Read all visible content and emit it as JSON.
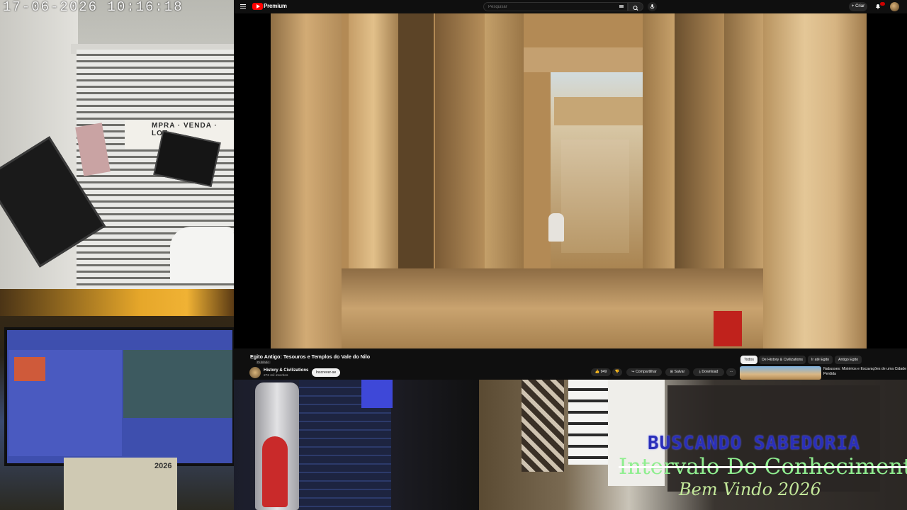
{
  "camera": {
    "timestamp": "17-06-2026  10:16:18",
    "sign_text": "MPRA · VENDA · LOT"
  },
  "youtube": {
    "brand": "Premium",
    "search_placeholder": "Pesquisar",
    "create_label": "+ Criar",
    "video_title": "Egito Antigo: Tesouros e Templos do Vale do Nilo",
    "verified_tag": "Dublado",
    "channel_name": "History & Civilizations",
    "subscribers": "276 mil inscritos",
    "subscribe_label": "Inscrever-se",
    "actions": {
      "likes": "949",
      "share": "Compartilhar",
      "save": "Salvar",
      "download": "Download",
      "more": "···"
    },
    "chips": [
      {
        "label": "Todos",
        "active": true
      },
      {
        "label": "De History & Civilizations",
        "active": false
      },
      {
        "label": "Ir até Egito",
        "active": false
      },
      {
        "label": "Antigo Egito",
        "active": false
      }
    ],
    "recommendation_title": "Nabusses: Mistérios e Escavações de uma Cidade Perdida"
  },
  "desk": {
    "calendar_year": "2026"
  },
  "overlay": {
    "line1": "BUSCANDO SABEDORIA",
    "line2": "Intervalo Do Conhecimento",
    "line3": "Bem Vindo 2026"
  },
  "colors": {
    "youtube_red": "#ff0000",
    "overlay_blue": "#2a2fb8",
    "overlay_green": "#90ee90",
    "overlay_yellow_green": "#c3e89a"
  }
}
